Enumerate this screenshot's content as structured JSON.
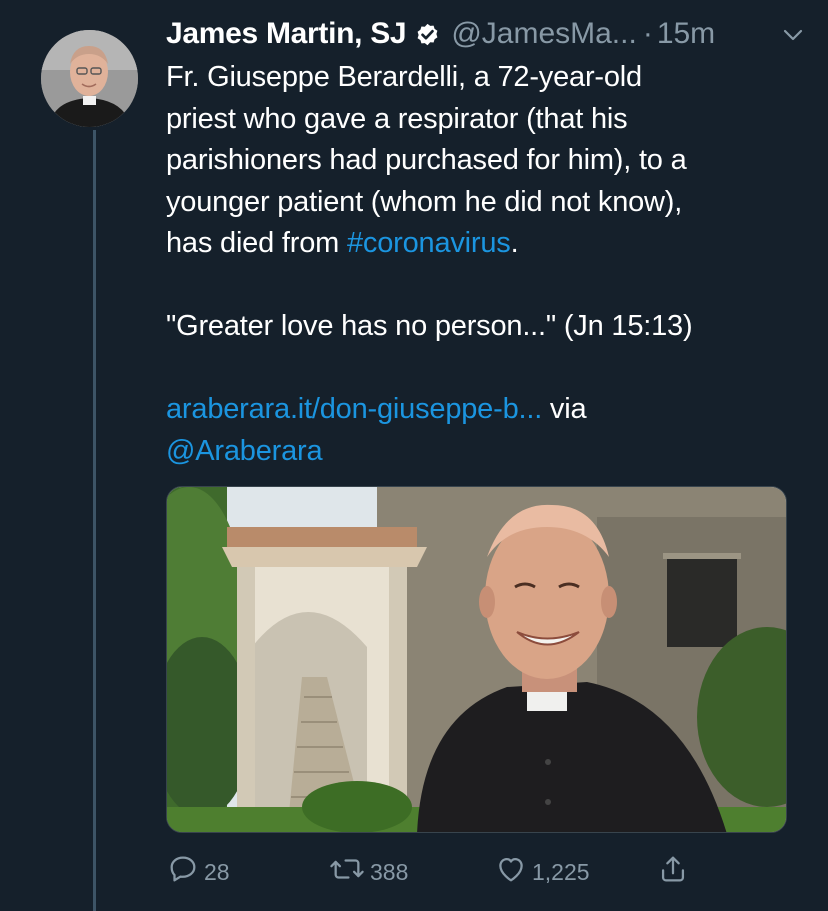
{
  "tweet": {
    "author_name": "James Martin, SJ",
    "verified_icon": "verified-badge-icon",
    "handle": "@JamesMa...",
    "separator": "·",
    "time": "15m",
    "menu_icon": "chevron-down-icon",
    "lines": {
      "l1": "Fr. Giuseppe Berardelli, a 72-year-old",
      "l2": "priest who gave a respirator (that his",
      "l3": "parishioners had purchased for him), to a",
      "l4": "younger patient (whom he did not know),",
      "l5_prefix": "has died from ",
      "hashtag": "#coronavirus",
      "l5_suffix": ".",
      "quote": "\"Greater love has no person...\" (Jn 15:13)",
      "url": "araberara.it/don-giuseppe-b...",
      "via": " via",
      "mention": "@Araberara"
    },
    "image_alt": "Smiling elderly priest in front of an arched stone building"
  },
  "actions": {
    "reply_count": "28",
    "retweet_count": "388",
    "like_count": "1,225",
    "reply_icon": "reply-icon",
    "retweet_icon": "retweet-icon",
    "like_icon": "heart-icon",
    "share_icon": "share-icon"
  },
  "colors": {
    "background": "#15202b",
    "text": "#ffffff",
    "secondary": "#8899a6",
    "link": "#1b95e0"
  }
}
